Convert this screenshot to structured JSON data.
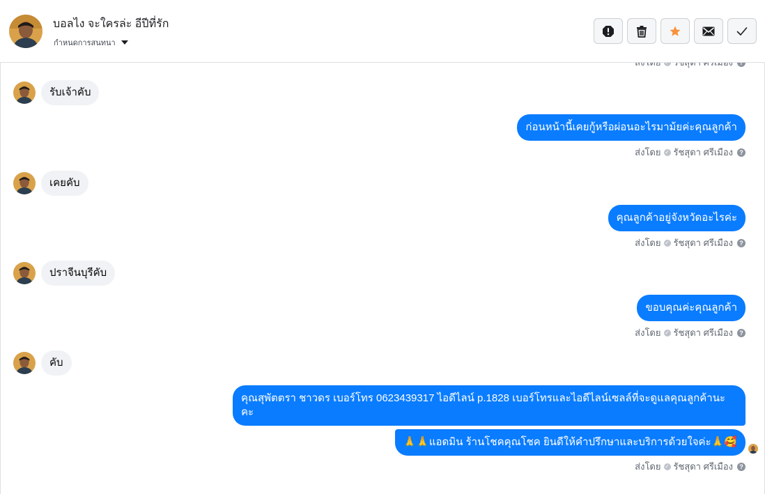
{
  "header": {
    "contact_name": "บอลไง จะใครล่ะ อีปีที่รัก",
    "assign_label": "กำหนดการสนทนา",
    "actions": [
      {
        "name": "mark-spam-button",
        "icon": "exclamation-octagon-icon"
      },
      {
        "name": "delete-button",
        "icon": "trash-icon"
      },
      {
        "name": "star-button",
        "icon": "star-icon",
        "color": "#f7923b"
      },
      {
        "name": "mark-unread-button",
        "icon": "envelope-icon"
      },
      {
        "name": "mark-done-button",
        "icon": "checkmark-icon"
      }
    ]
  },
  "colors": {
    "outgoing_bubble": "#0a7cff",
    "incoming_bubble": "#f0f2f5",
    "star": "#f7923b"
  },
  "meta": {
    "sent_by_label": "ส่งโดย",
    "sender_name": "รัชสุดา ศรีเมือง"
  },
  "messages": [
    {
      "direction": "in",
      "text": "รับเจ้าคับ"
    },
    {
      "direction": "out",
      "text": "ก่อนหน้านี้เคยกู้หรือผ่อนอะไรมาม้ยค่ะคุณลูกค้า"
    },
    {
      "direction": "in",
      "text": "เคยคับ"
    },
    {
      "direction": "out",
      "text": "คุณลูกค้าอยู่จังหวัดอะไรค่ะ"
    },
    {
      "direction": "in",
      "text": "ปราจีนบุรีคับ"
    },
    {
      "direction": "out",
      "text": "ขอบคุณค่ะคุณลูกค้า"
    },
    {
      "direction": "in",
      "text": "คับ"
    },
    {
      "direction": "out",
      "text": "คุณสุพัตตรา   ชาวดร      เบอร์โทร 0623439317  ไอดีไลน์ p.1828   เบอร์โทรและไอดีไลน์เซลล์ที่จะดูแลคุณลูกค้านะคะ"
    },
    {
      "direction": "out",
      "text": "🙏🙏แอดมิน ร้านโชคคุณโชค ยินดีให้คำปรึกษาและบริการด้วยใจค่ะ🙏🥰"
    }
  ]
}
